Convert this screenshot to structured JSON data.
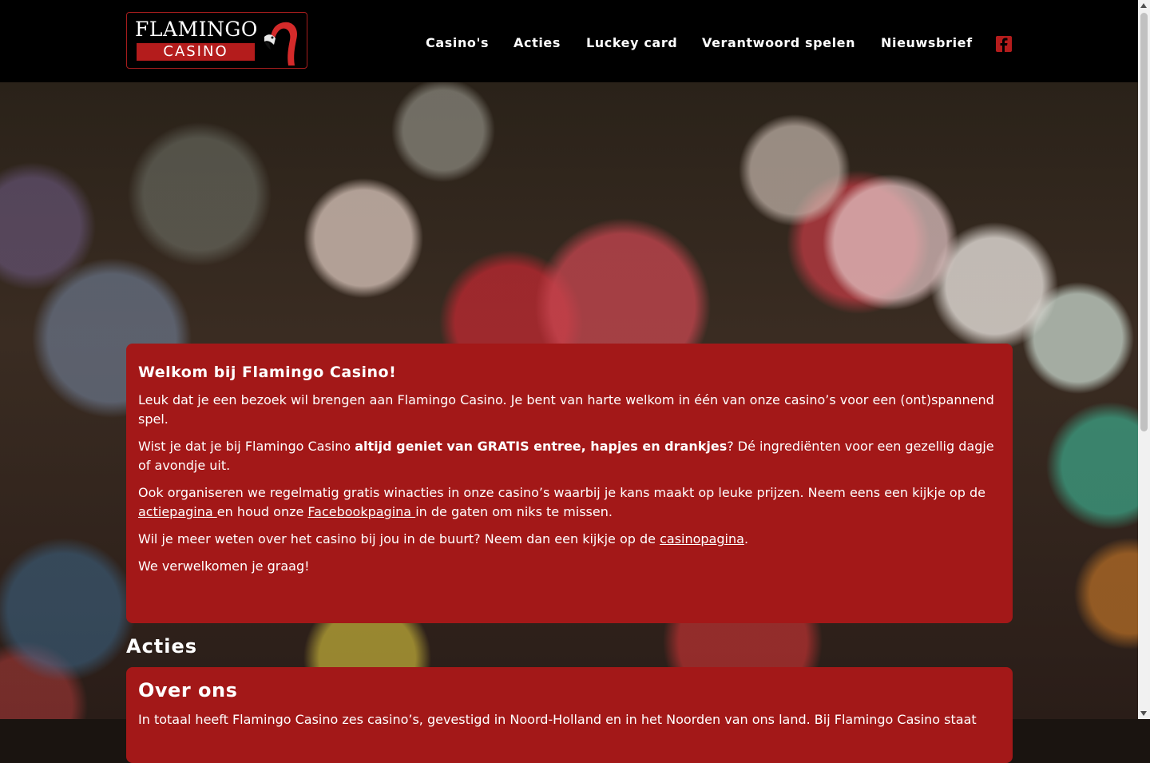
{
  "header": {
    "logo": {
      "line1": "FLAMINGO",
      "line2": "CASINO"
    },
    "nav": [
      {
        "label": "Casino's"
      },
      {
        "label": "Acties"
      },
      {
        "label": "Luckey card"
      },
      {
        "label": "Verantwoord spelen"
      },
      {
        "label": "Nieuwsbrief"
      }
    ],
    "social_icon": "facebook-icon"
  },
  "welcome": {
    "title": "Welkom bij Flamingo Casino!",
    "p1": "Leuk dat je een bezoek wil brengen aan Flamingo Casino. Je bent van harte welkom in één van onze casino’s voor een (ont)spannend spel.",
    "p2_before": "Wist je dat je bij Flamingo Casino ",
    "p2_bold": "altijd geniet van GRATIS entree, hapjes en drankjes",
    "p2_after": "? Dé ingrediënten voor een gezellig dagje of avondje uit.",
    "p3_before": "Ook organiseren we regelmatig gratis winacties in onze casino’s waarbij je kans maakt op leuke prijzen. Neem eens een kijkje op de ",
    "p3_link1": "actiepagina ",
    "p3_middle": "en houd onze ",
    "p3_link2": "Facebookpagina ",
    "p3_after": "in de gaten om niks te missen.",
    "p4_before": "Wil je meer weten over het casino bij jou in de buurt? Neem dan een kijkje op de ",
    "p4_link": "casinopagina",
    "p4_after": ".",
    "p5": "We verwelkomen je graag!"
  },
  "acties": {
    "title": "Acties"
  },
  "over_ons": {
    "title": "Over ons",
    "text": "In totaal heeft Flamingo Casino zes casino’s, gevestigd in Noord-Holland en in het Noorden van ons land. Bij Flamingo Casino staat"
  },
  "colors": {
    "brand_red": "#a31818",
    "header_bg": "#000000"
  }
}
